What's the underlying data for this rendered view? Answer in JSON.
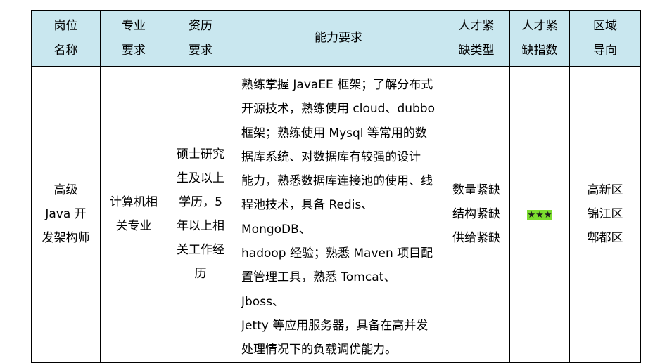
{
  "headers": [
    {
      "l1": "岗位",
      "l2": "名称"
    },
    {
      "l1": "专业",
      "l2": "要求"
    },
    {
      "l1": "资历",
      "l2": "要求"
    },
    {
      "l1": "能力要求",
      "l2": ""
    },
    {
      "l1": "人才紧",
      "l2": "缺类型"
    },
    {
      "l1": "人才紧",
      "l2": "缺指数"
    },
    {
      "l1": "区域",
      "l2": "导向"
    }
  ],
  "row": {
    "position": [
      "高级",
      "Java 开",
      "发架构师"
    ],
    "major": [
      "计算机相",
      "关专业"
    ],
    "experience": [
      "硕士研究",
      "生及以上",
      "学历，5",
      "年以上相",
      "关工作经",
      "历"
    ],
    "skills": [
      "熟练掌握 JavaEE 框架；了解分布式",
      "开源技术，熟练使用 cloud、dubbo",
      "框架；熟练使用 Mysql 等常用的数",
      "据库系统、对数据库有较强的设计",
      "能力，熟悉数据库连接池的使用、线",
      "程池技术，具备 Redis、MongoDB、",
      "hadoop 经验；熟悉 Maven 项目配",
      "置管理工具，熟悉 Tomcat、Jboss、",
      "Jetty 等应用服务器，具备在高并发",
      "处理情况下的负载调优能力。"
    ],
    "shortage_type": [
      "数量紧缺",
      "结构紧缺",
      "供给紧缺"
    ],
    "shortage_index": "★★★",
    "regions": [
      "高新区",
      "锦江区",
      "郫都区"
    ]
  },
  "colors": {
    "header_bg": "#c9e7ef",
    "star_highlight": "#7bdc2f"
  }
}
